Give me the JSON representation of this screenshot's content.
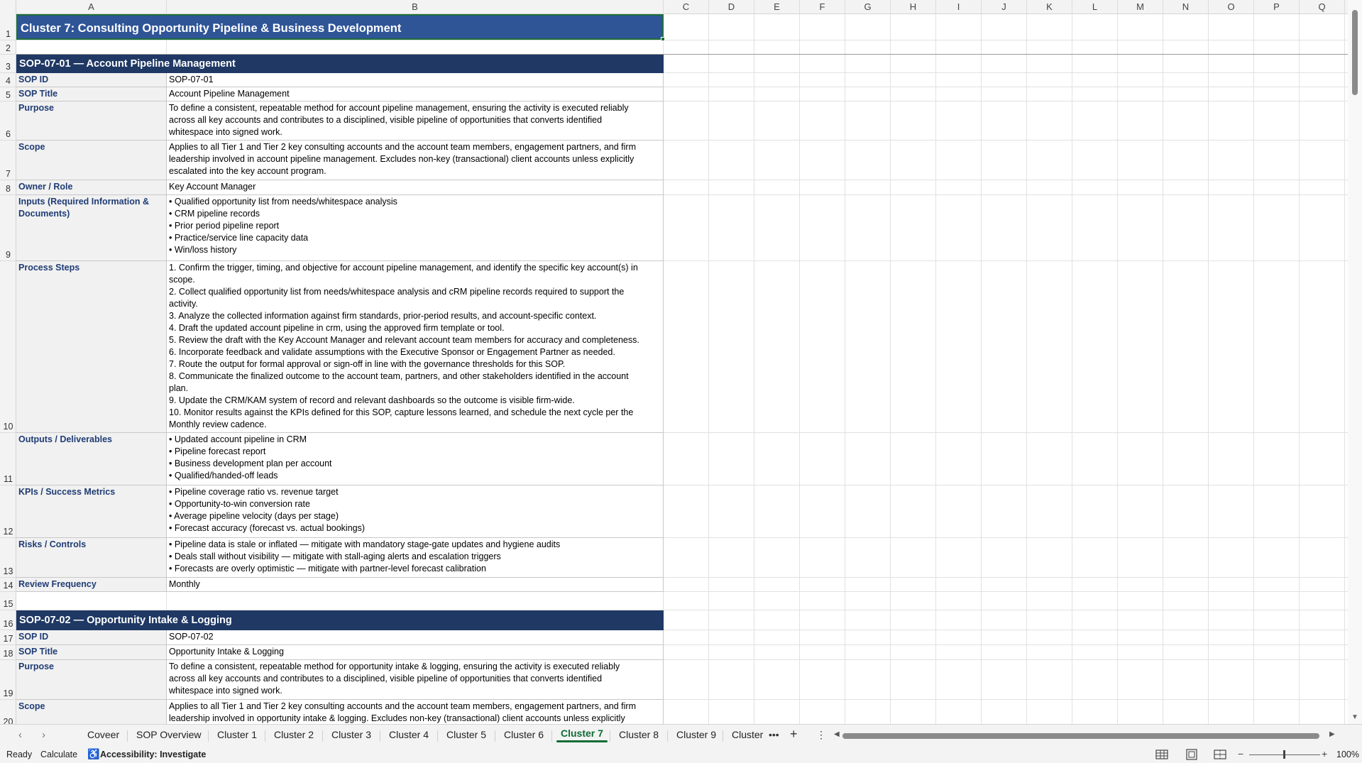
{
  "columns": [
    "A",
    "B",
    "C",
    "D",
    "E",
    "F",
    "G",
    "H",
    "I",
    "J",
    "K",
    "L",
    "M",
    "N",
    "O",
    "P",
    "Q"
  ],
  "rows": [
    "1",
    "2",
    "3",
    "4",
    "5",
    "6",
    "7",
    "8",
    "9",
    "10",
    "11",
    "12",
    "13",
    "14",
    "15",
    "16",
    "17",
    "18",
    "19",
    "20"
  ],
  "sheet": {
    "title": "Cluster 7: Consulting Opportunity Pipeline & Business Development",
    "sop1": {
      "header": "SOP-07-01  —  Account Pipeline Management",
      "labels": {
        "sop_id": "SOP ID",
        "sop_title": "SOP Title",
        "purpose": "Purpose",
        "scope": "Scope",
        "owner": "Owner / Role",
        "inputs": "Inputs (Required Information & Documents)",
        "steps": "Process Steps",
        "outputs": "Outputs / Deliverables",
        "kpis": "KPIs / Success Metrics",
        "risks": "Risks / Controls",
        "review": "Review Frequency"
      },
      "values": {
        "sop_id": "SOP-07-01",
        "sop_title": "Account Pipeline Management",
        "purpose": "To define a consistent, repeatable method for account pipeline management, ensuring the activity is executed reliably\nacross all key accounts and contributes to a disciplined, visible pipeline of opportunities that converts identified\nwhitespace into signed work.",
        "scope": "Applies to all Tier 1 and Tier 2 key consulting accounts and the account team members, engagement partners, and firm\nleadership involved in account pipeline management. Excludes non-key (transactional) client accounts unless explicitly\nescalated into the key account program.",
        "owner": "Key Account Manager",
        "inputs": "• Qualified opportunity list from needs/whitespace analysis\n• CRM pipeline records\n• Prior period pipeline report\n• Practice/service line capacity data\n• Win/loss history",
        "steps": "1. Confirm the trigger, timing, and objective for account pipeline management, and identify the specific key account(s) in\nscope.\n2. Collect qualified opportunity list from needs/whitespace analysis and cRM pipeline records required to support the\nactivity.\n3. Analyze the collected information against firm standards, prior-period results, and account-specific context.\n4. Draft the updated account pipeline in crm, using the approved firm template or tool.\n5. Review the draft with the Key Account Manager and relevant account team members for accuracy and completeness.\n6. Incorporate feedback and validate assumptions with the Executive Sponsor or Engagement Partner as needed.\n7. Route the output for formal approval or sign-off in line with the governance thresholds for this SOP.\n8. Communicate the finalized outcome to the account team, partners, and other stakeholders identified in the account\nplan.\n9. Update the CRM/KAM system of record and relevant dashboards so the outcome is visible firm-wide.\n10. Monitor results against the KPIs defined for this SOP, capture lessons learned, and schedule the next cycle per the\nMonthly review cadence.",
        "outputs": "• Updated account pipeline in CRM\n• Pipeline forecast report\n• Business development plan per account\n• Qualified/handed-off leads",
        "kpis": "• Pipeline coverage ratio vs. revenue target\n• Opportunity-to-win conversion rate\n• Average pipeline velocity (days per stage)\n• Forecast accuracy (forecast vs. actual bookings)",
        "risks": "• Pipeline data is stale or inflated — mitigate with mandatory stage-gate updates and hygiene audits\n• Deals stall without visibility — mitigate with stall-aging alerts and escalation triggers\n• Forecasts are overly optimistic — mitigate with partner-level forecast calibration",
        "review": "Monthly"
      }
    },
    "sop2": {
      "header": "SOP-07-02  —  Opportunity Intake & Logging",
      "labels": {
        "sop_id": "SOP ID",
        "sop_title": "SOP Title",
        "purpose": "Purpose",
        "scope": "Scope"
      },
      "values": {
        "sop_id": "SOP-07-02",
        "sop_title": "Opportunity Intake & Logging",
        "purpose": "To define a consistent, repeatable method for opportunity intake & logging, ensuring the activity is executed reliably\nacross all key accounts and contributes to a disciplined, visible pipeline of opportunities that converts identified\nwhitespace into signed work.",
        "scope": "Applies to all Tier 1 and Tier 2 key consulting accounts and the account team members, engagement partners, and firm\nleadership involved in opportunity intake & logging. Excludes non-key (transactional) client accounts unless explicitly"
      }
    }
  },
  "tabs": [
    "Coveer",
    "SOP Overview",
    "Cluster 1",
    "Cluster 2",
    "Cluster 3",
    "Cluster 4",
    "Cluster 5",
    "Cluster 6",
    "Cluster 7",
    "Cluster 8",
    "Cluster 9",
    "Cluster"
  ],
  "active_tab": "Cluster 7",
  "status": {
    "ready": "Ready",
    "calculate": "Calculate",
    "accessibility": "Accessibility: Investigate",
    "zoom": "100%"
  },
  "colors": {
    "title_fill": "#2f5597",
    "section_fill": "#1f3864",
    "label_text": "#1f3c74",
    "active_tab": "#0f6b35"
  }
}
